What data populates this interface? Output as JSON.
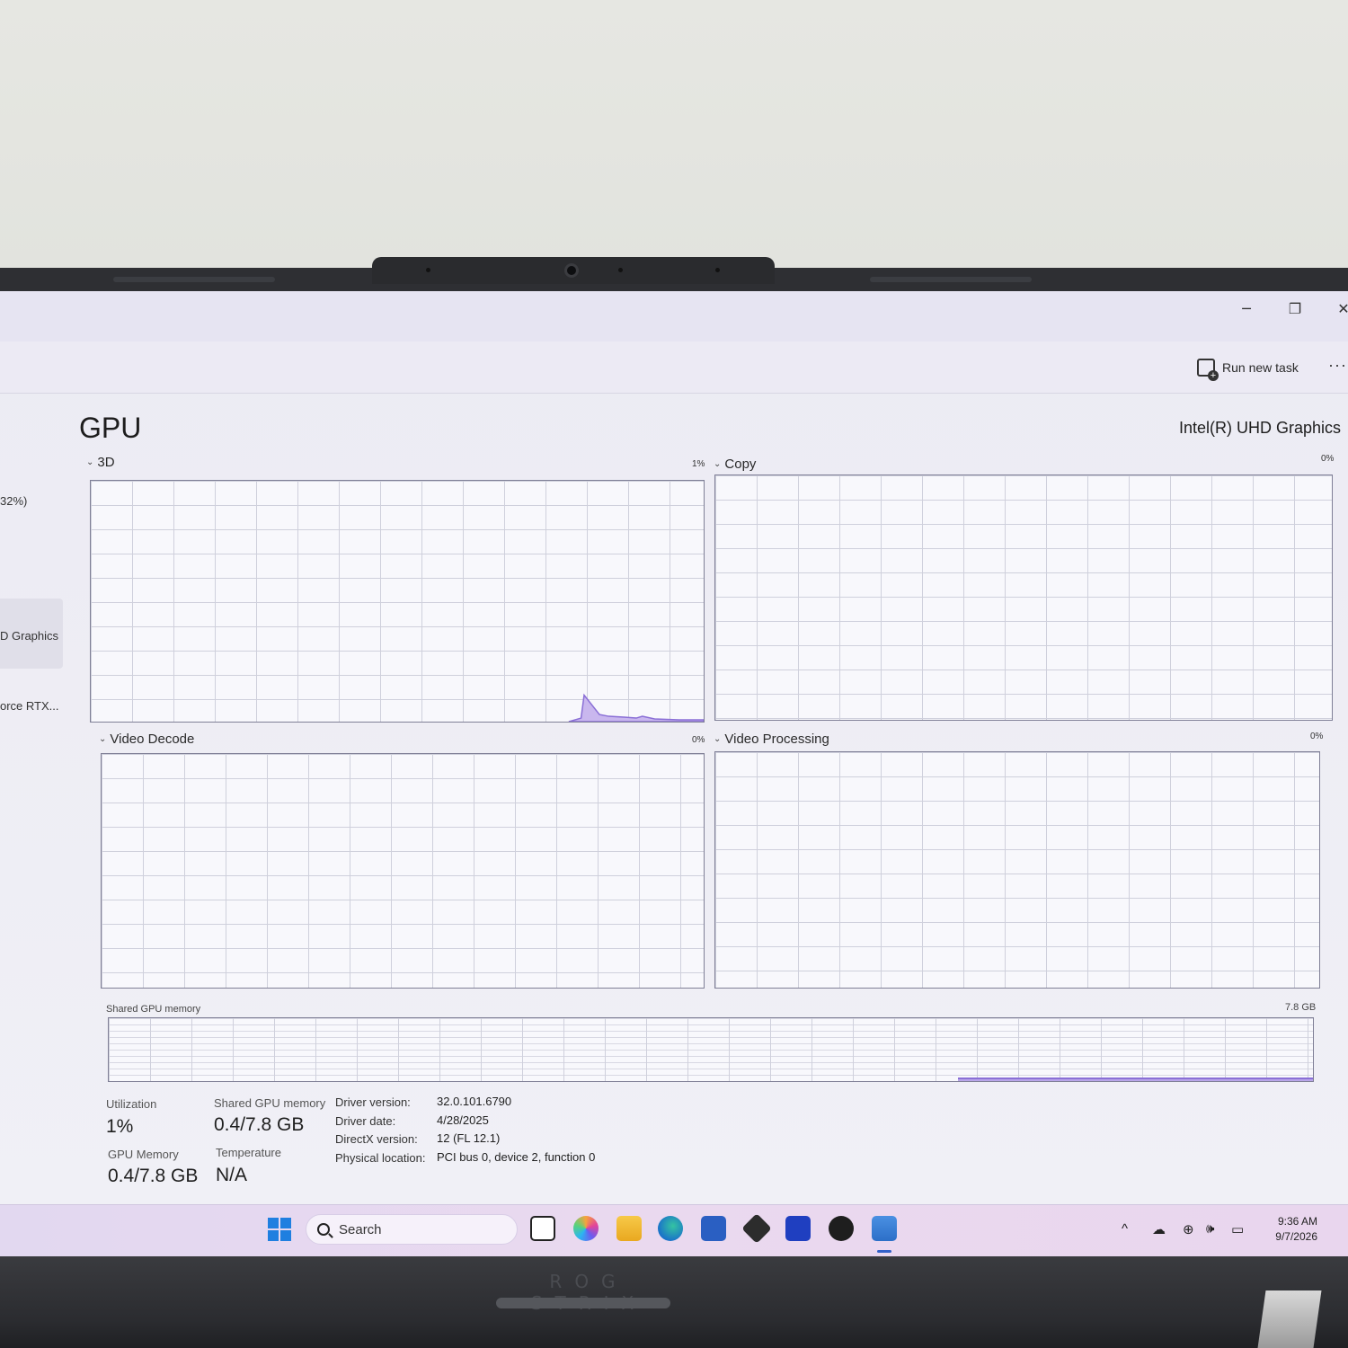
{
  "window": {
    "minimize_glyph": "─",
    "restore_glyph": "❐",
    "close_glyph": "✕"
  },
  "toolbar": {
    "run_new_task": "Run new task",
    "more_glyph": "···"
  },
  "sidebar": {
    "items": [
      {
        "label": "32%)"
      },
      {
        "label": "D Graphics"
      },
      {
        "label": "orce RTX..."
      }
    ]
  },
  "main": {
    "title": "GPU",
    "gpu_name": "Intel(R) UHD Graphics",
    "graphs": [
      {
        "label": "3D",
        "percent": "1%",
        "utilization_fraction_peak": 0.11
      },
      {
        "label": "Copy",
        "percent": "0%"
      },
      {
        "label": "Video Decode",
        "percent": "0%"
      },
      {
        "label": "Video Processing",
        "percent": "0%"
      }
    ],
    "shared_memory": {
      "label": "Shared GPU memory",
      "max": "7.8 GB",
      "used_fraction": 0.05
    },
    "stats": {
      "utilization_label": "Utilization",
      "utilization_value": "1%",
      "shared_label": "Shared GPU memory",
      "shared_value": "0.4/7.8 GB",
      "gpu_memory_label": "GPU Memory",
      "gpu_memory_value": "0.4/7.8 GB",
      "temperature_label": "Temperature",
      "temperature_value": "N/A"
    },
    "info": {
      "driver_version_key": "Driver version:",
      "driver_version": "32.0.101.6790",
      "driver_date_key": "Driver date:",
      "driver_date": "4/28/2025",
      "directx_key": "DirectX version:",
      "directx": "12 (FL 12.1)",
      "location_key": "Physical location:",
      "location": "PCI bus 0, device 2, function 0"
    },
    "accent_color": "#8a6fd6"
  },
  "taskbar": {
    "search_placeholder": "Search",
    "icons": [
      "windows-start-icon",
      "task-view-icon",
      "copilot-icon",
      "file-explorer-icon",
      "edge-icon",
      "store-icon",
      "app-cube-icon",
      "armoury-crate-icon",
      "xbox-icon",
      "task-manager-icon"
    ],
    "tray": {
      "chevron": "^",
      "time": "9:36 AM",
      "date": "9/7/2026"
    }
  },
  "hardware": {
    "brand": "ROG STRIX"
  }
}
